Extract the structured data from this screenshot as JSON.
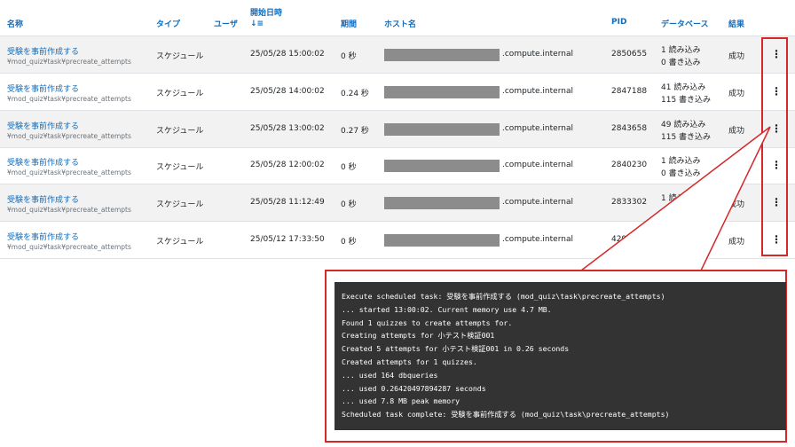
{
  "table": {
    "headers": {
      "name": "名称",
      "type": "タイプ",
      "user": "ユーザ",
      "start": "開始日時",
      "duration": "期間",
      "host": "ホスト名",
      "pid": "PID",
      "database": "データベース",
      "result": "結果"
    },
    "rows": [
      {
        "name": "受験を事前作成する",
        "component": "¥mod_quiz¥task¥precreate_attempts",
        "type": "スケジュール",
        "start": "25/05/28 15:00:02",
        "duration": "0 秒",
        "host": ".compute.internal",
        "pid": "2850655",
        "db_read": "1 読み込み",
        "db_write": "0 書き込み",
        "result": "成功"
      },
      {
        "name": "受験を事前作成する",
        "component": "¥mod_quiz¥task¥precreate_attempts",
        "type": "スケジュール",
        "start": "25/05/28 14:00:02",
        "duration": "0.24 秒",
        "host": ".compute.internal",
        "pid": "2847188",
        "db_read": "41 読み込み",
        "db_write": "115 書き込み",
        "result": "成功"
      },
      {
        "name": "受験を事前作成する",
        "component": "¥mod_quiz¥task¥precreate_attempts",
        "type": "スケジュール",
        "start": "25/05/28 13:00:02",
        "duration": "0.27 秒",
        "host": ".compute.internal",
        "pid": "2843658",
        "db_read": "49 読み込み",
        "db_write": "115 書き込み",
        "result": "成功"
      },
      {
        "name": "受験を事前作成する",
        "component": "¥mod_quiz¥task¥precreate_attempts",
        "type": "スケジュール",
        "start": "25/05/28 12:00:02",
        "duration": "0 秒",
        "host": ".compute.internal",
        "pid": "2840230",
        "db_read": "1 読み込み",
        "db_write": "0 書き込み",
        "result": ""
      },
      {
        "name": "受験を事前作成する",
        "component": "¥mod_quiz¥task¥precreate_attempts",
        "type": "スケジュール",
        "start": "25/05/28 11:12:49",
        "duration": "0 秒",
        "host": ".compute.internal",
        "pid": "2833302",
        "db_read": "1 読み込み",
        "db_write": "",
        "result": "成功"
      },
      {
        "name": "受験を事前作成する",
        "component": "¥mod_quiz¥task¥precreate_attempts",
        "type": "スケジュール",
        "start": "25/05/12 17:33:50",
        "duration": "0 秒",
        "host": ".compute.internal",
        "pid": "4291",
        "db_read": "",
        "db_write": "",
        "result": "成功"
      }
    ]
  },
  "icons": {
    "sort": "sort-ascending-icon",
    "row_menu": "kebab-menu-icon"
  },
  "colors": {
    "link": "#0f6cbf",
    "highlight": "#d6282b",
    "console_bg": "#333333",
    "stripe": "#f2f2f2"
  },
  "console": {
    "lines": [
      "Execute scheduled task: 受験を事前作成する (mod_quiz\\task\\precreate_attempts)",
      "... started 13:00:02. Current memory use 4.7 MB.",
      "Found 1 quizzes to create attempts for.",
      "Creating attempts for 小テスト検証001",
      "Created 5 attempts for 小テスト検証001 in 0.26 seconds",
      "Created attempts for 1 quizzes.",
      "... used 164 dbqueries",
      "... used 0.26420497894287 seconds",
      "... used 7.8 MB peak memory",
      "Scheduled task complete: 受験を事前作成する (mod_quiz\\task\\precreate_attempts)"
    ]
  }
}
